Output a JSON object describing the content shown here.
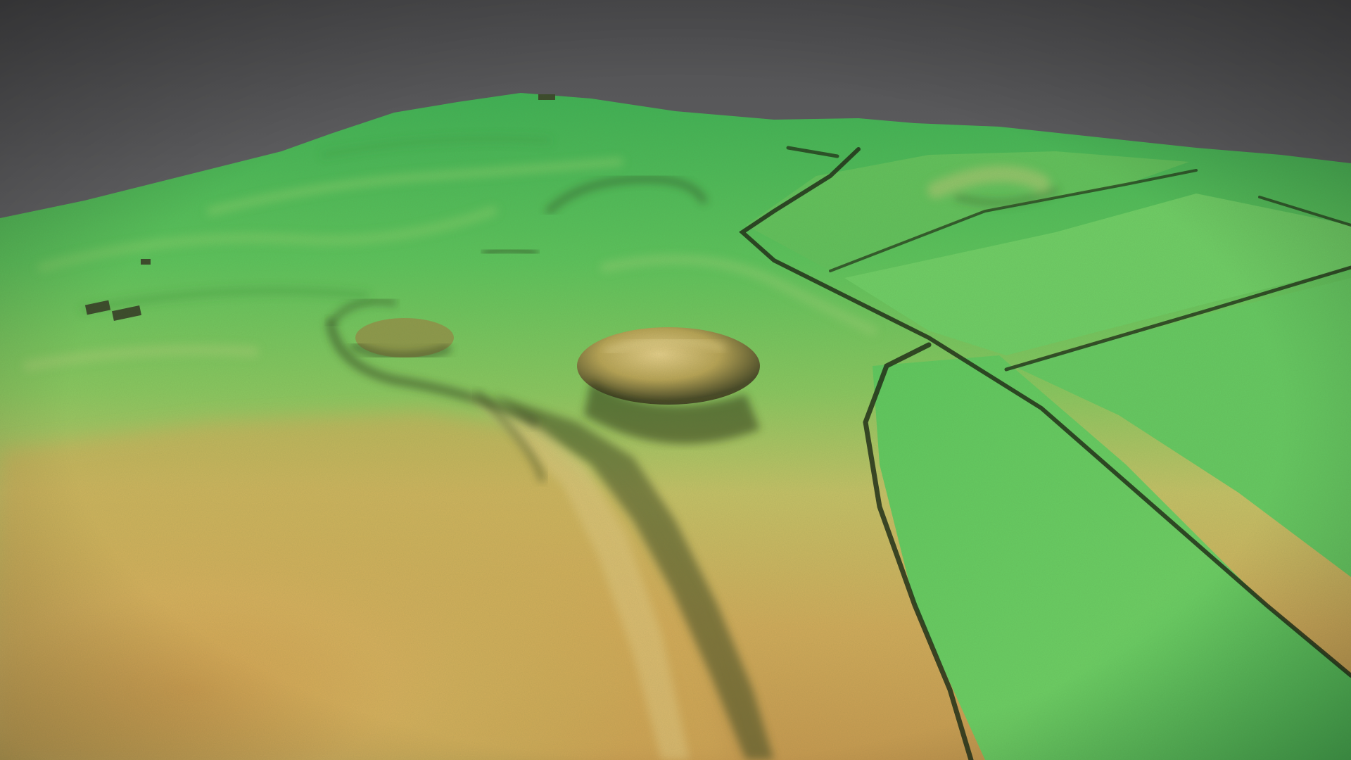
{
  "scene": {
    "kind": "3d-lidar-terrain-render",
    "colors": {
      "sky_top": "#4f4f51",
      "sky_bottom": "#707072",
      "high_green": "#4dc25a",
      "mid_green": "#69c65e",
      "field_green": "#6fcf63",
      "low_yellow": "#d9c06a",
      "low_tan": "#c69a52",
      "shadow": "#2f3a1f"
    }
  }
}
